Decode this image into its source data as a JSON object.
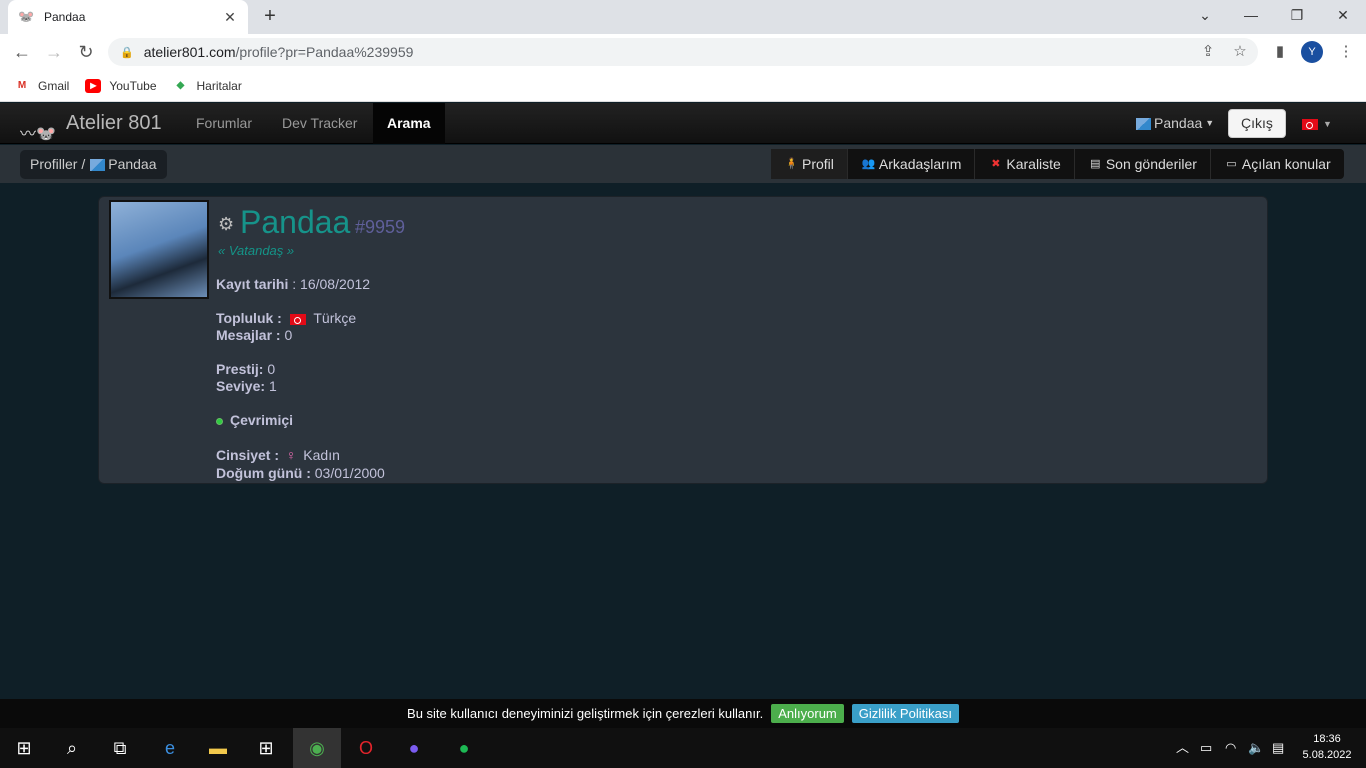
{
  "browser": {
    "tab_title": "Pandaa",
    "url_host": "atelier801.com",
    "url_path": "/profile?pr=Pandaa%239959",
    "profile_initial": "Y",
    "bookmarks": [
      {
        "label": "Gmail"
      },
      {
        "label": "YouTube"
      },
      {
        "label": "Haritalar"
      }
    ]
  },
  "site": {
    "brand": "Atelier 801",
    "nav": {
      "forums": "Forumlar",
      "devtracker": "Dev Tracker",
      "search": "Arama"
    },
    "user": "Pandaa",
    "logout": "Çıkış"
  },
  "breadcrumb": {
    "root": "Profiller /",
    "user": "Pandaa"
  },
  "profile_tabs": {
    "profile": "Profil",
    "friends": "Arkadaşlarım",
    "blacklist": "Karaliste",
    "recent_posts": "Son gönderiler",
    "opened_topics": "Açılan konular"
  },
  "profile": {
    "name": "Pandaa",
    "tag": "#9959",
    "rank": "« Vatandaş »",
    "registered_label": "Kayıt tarihi",
    "registered_value": ": 16/08/2012",
    "community_label": "Topluluk :",
    "community_value": "Türkçe",
    "messages_label": "Mesajlar :",
    "messages_value": "0",
    "prestige_label": "Prestij:",
    "prestige_value": "0",
    "level_label": "Seviye:",
    "level_value": "1",
    "status": "Çevrimiçi",
    "gender_label": "Cinsiyet :",
    "gender_value": "Kadın",
    "birthday_label": "Doğum günü :",
    "birthday_value": "03/01/2000"
  },
  "cookie": {
    "message": "Bu site kullanıcı deneyiminizi geliştirmek için çerezleri kullanır.",
    "accept": "Anlıyorum",
    "privacy": "Gizlilik Politikası"
  },
  "taskbar": {
    "time": "18:36",
    "date": "5.08.2022"
  }
}
